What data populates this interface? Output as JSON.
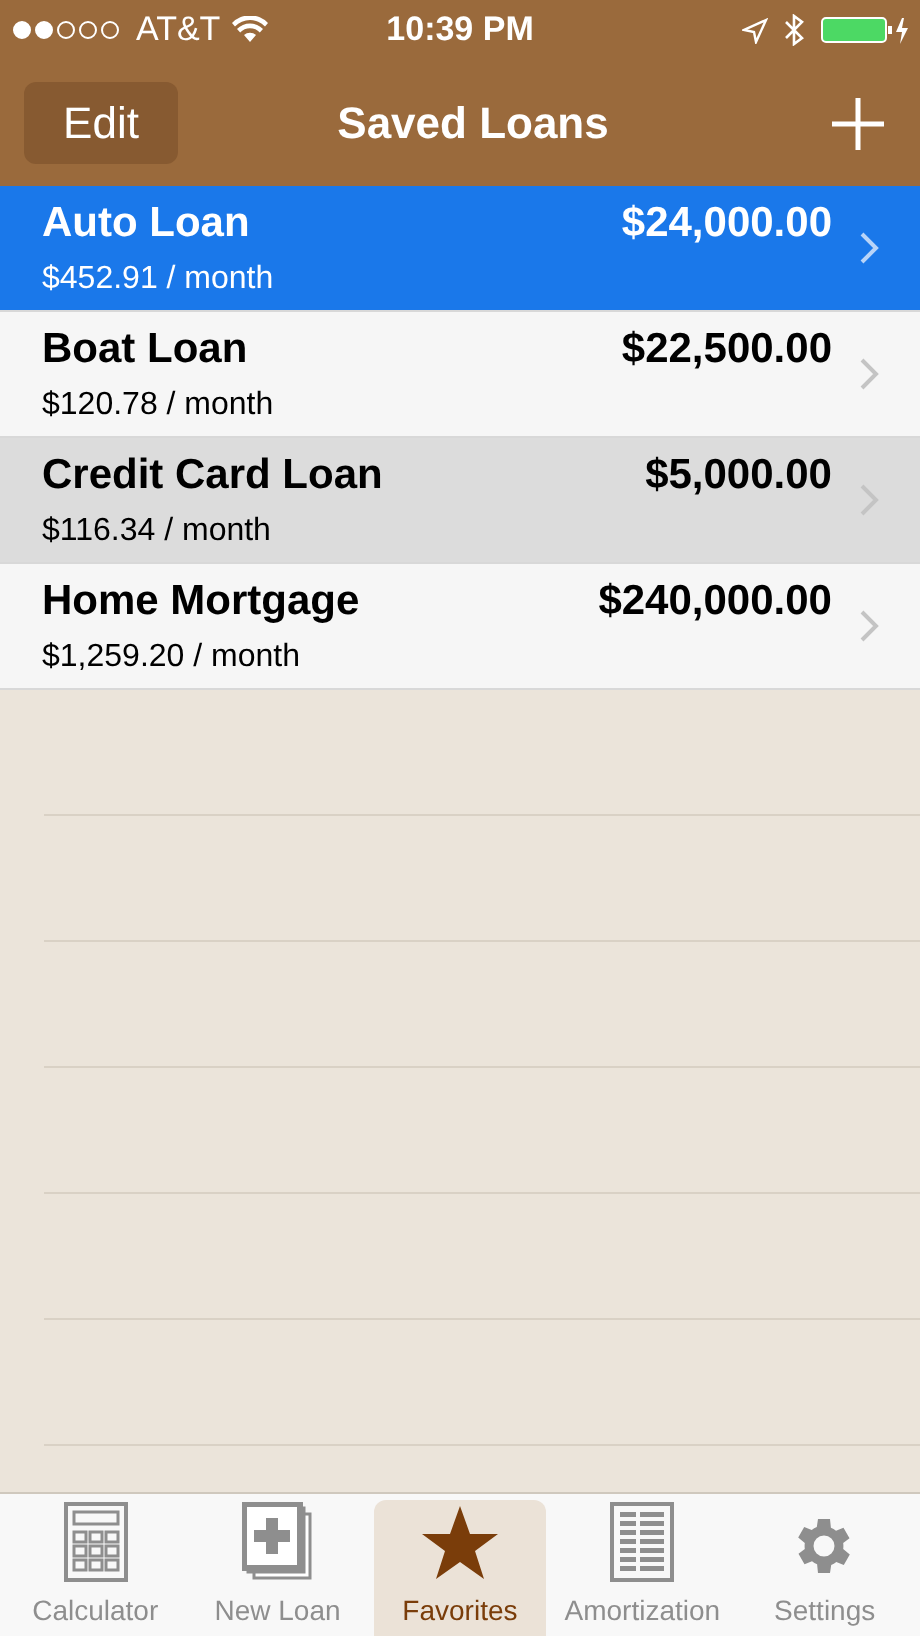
{
  "status_bar": {
    "carrier": "AT&T",
    "time": "10:39 PM"
  },
  "nav": {
    "edit": "Edit",
    "title": "Saved Loans"
  },
  "loans": [
    {
      "name": "Auto Loan",
      "payment": "$452.91 / month",
      "amount": "$24,000.00",
      "selected": true,
      "highlighted": false
    },
    {
      "name": "Boat Loan",
      "payment": "$120.78 / month",
      "amount": "$22,500.00",
      "selected": false,
      "highlighted": false
    },
    {
      "name": "Credit Card Loan",
      "payment": "$116.34 / month",
      "amount": "$5,000.00",
      "selected": false,
      "highlighted": true
    },
    {
      "name": "Home Mortgage",
      "payment": "$1,259.20 / month",
      "amount": "$240,000.00",
      "selected": false,
      "highlighted": false
    }
  ],
  "tabs": [
    {
      "label": "Calculator",
      "kind": "calculator",
      "selected": false
    },
    {
      "label": "New Loan",
      "kind": "new",
      "selected": false
    },
    {
      "label": "Favorites",
      "kind": "star",
      "selected": true
    },
    {
      "label": "Amortization",
      "kind": "table",
      "selected": false
    },
    {
      "label": "Settings",
      "kind": "gear",
      "selected": false
    }
  ]
}
